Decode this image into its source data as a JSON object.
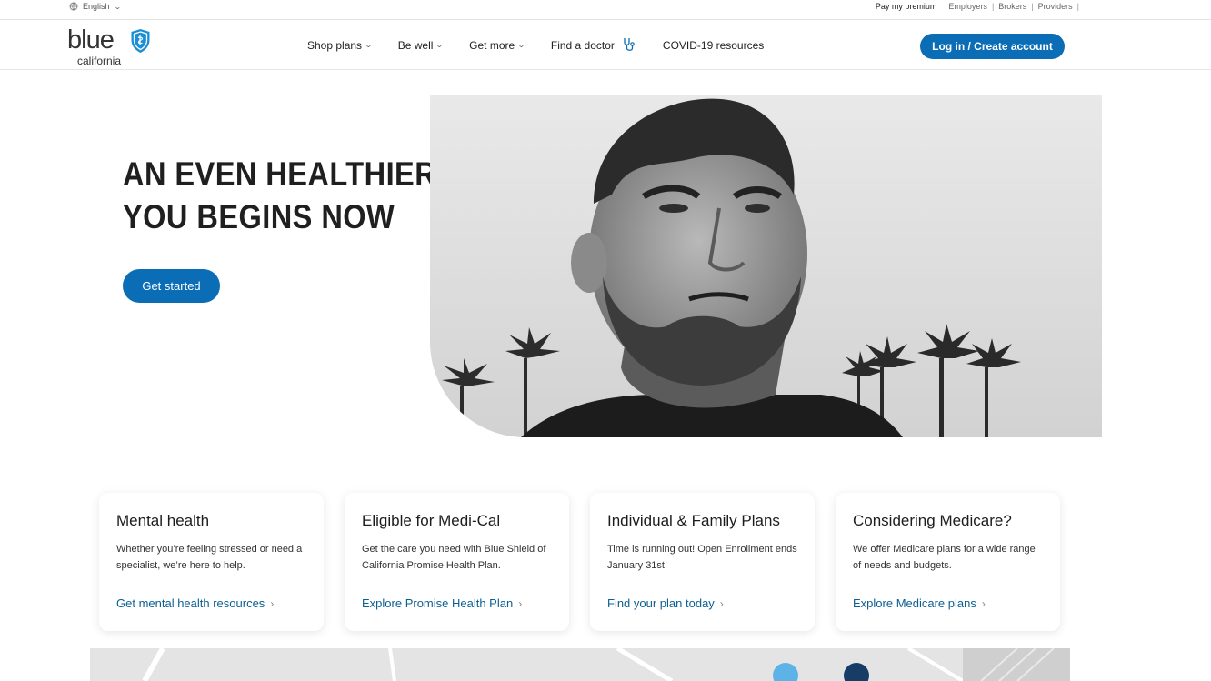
{
  "utility": {
    "language": "English",
    "links": [
      "Pay my premium",
      "Employers",
      "Brokers",
      "Providers"
    ]
  },
  "logo": {
    "word": "blue",
    "sub": "california"
  },
  "nav": {
    "items": [
      {
        "label": "Shop plans",
        "dropdown": true
      },
      {
        "label": "Be well",
        "dropdown": true
      },
      {
        "label": "Get more",
        "dropdown": true
      },
      {
        "label": "Find a doctor",
        "dropdown": false,
        "icon": "stethoscope-icon"
      },
      {
        "label": "COVID-19 resources",
        "dropdown": false
      }
    ],
    "login_label": "Log in / Create account"
  },
  "hero": {
    "title_line1": "AN EVEN HEALTHIER",
    "title_line2": "YOU BEGINS NOW",
    "cta": "Get started"
  },
  "cards": [
    {
      "title": "Mental health",
      "text": "Whether you’re feeling stressed or need a specialist, we’re here to help.",
      "link": "Get mental health resources"
    },
    {
      "title": "Eligible for Medi-Cal",
      "text": "Get the care you need with Blue Shield of California Promise Health Plan.",
      "link": "Explore Promise Health Plan"
    },
    {
      "title": "Individual & Family Plans",
      "text": "Time is running out! Open Enrollment ends January 31st!",
      "link": "Find your plan today"
    },
    {
      "title": "Considering Medicare?",
      "text": "We offer Medicare plans for a wide range of needs and budgets.",
      "link": "Explore Medicare plans"
    }
  ],
  "colors": {
    "brand_blue": "#0b6db5",
    "link_blue": "#0b5f93",
    "shield_blue": "#1a8fd6"
  }
}
